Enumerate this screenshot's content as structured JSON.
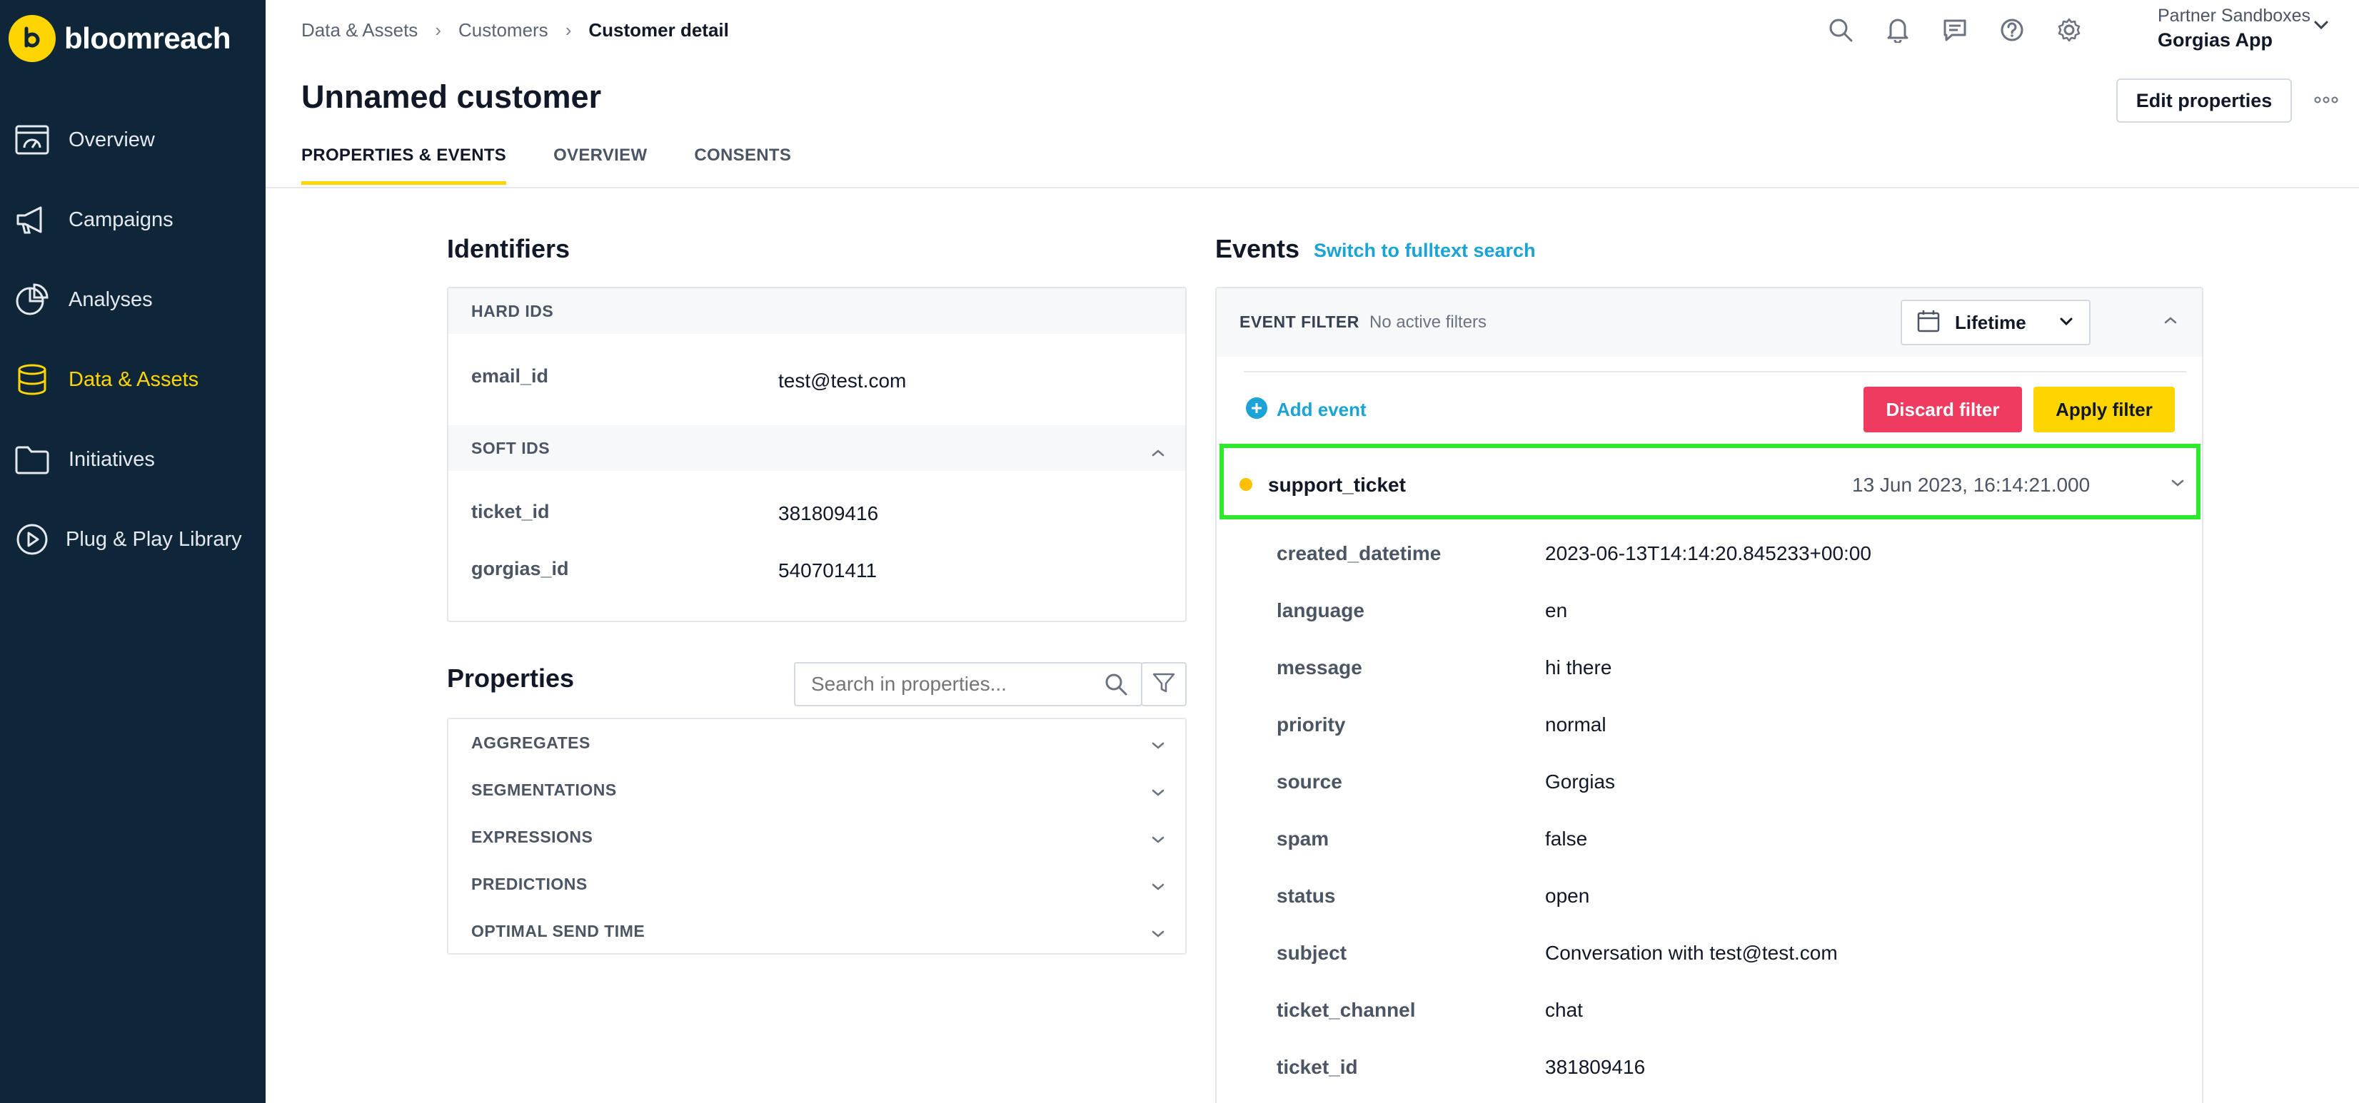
{
  "brand": {
    "name": "bloomreach",
    "accent": "#ffd500",
    "sidebar_bg": "#0f2639"
  },
  "sidebar": {
    "items": [
      {
        "label": "Overview",
        "icon": "dashboard-icon"
      },
      {
        "label": "Campaigns",
        "icon": "megaphone-icon"
      },
      {
        "label": "Analyses",
        "icon": "pie-chart-icon"
      },
      {
        "label": "Data & Assets",
        "icon": "database-icon",
        "active": true
      },
      {
        "label": "Initiatives",
        "icon": "folder-icon"
      },
      {
        "label": "Plug & Play Library",
        "icon": "play-circle-icon"
      }
    ]
  },
  "breadcrumb": {
    "items": [
      "Data & Assets",
      "Customers"
    ],
    "current": "Customer detail"
  },
  "topbar": {
    "icons": [
      "search-icon",
      "bell-icon",
      "chat-icon",
      "help-icon",
      "gear-icon"
    ],
    "account_sub": "Partner Sandboxes",
    "account_name": "Gorgias App"
  },
  "page": {
    "title": "Unnamed customer",
    "edit_label": "Edit properties",
    "tabs": [
      "PROPERTIES & EVENTS",
      "OVERVIEW",
      "CONSENTS"
    ],
    "active_tab": "PROPERTIES & EVENTS"
  },
  "identifiers": {
    "title": "Identifiers",
    "hard_ids_label": "HARD IDS",
    "hard_ids": [
      {
        "key": "email_id",
        "value": "test@test.com"
      }
    ],
    "soft_ids_label": "SOFT IDS",
    "soft_ids": [
      {
        "key": "ticket_id",
        "value": "381809416"
      },
      {
        "key": "gorgias_id",
        "value": "540701411"
      }
    ]
  },
  "properties": {
    "title": "Properties",
    "search_placeholder": "Search in properties...",
    "groups": [
      "AGGREGATES",
      "SEGMENTATIONS",
      "EXPRESSIONS",
      "PREDICTIONS",
      "OPTIMAL SEND TIME"
    ]
  },
  "events": {
    "title": "Events",
    "switch_link": "Switch to fulltext search",
    "filter_label": "EVENT FILTER",
    "filter_note": "No active filters",
    "range": "Lifetime",
    "add_event": "Add event",
    "discard": "Discard filter",
    "apply": "Apply filter",
    "event": {
      "name": "support_ticket",
      "time": "13 Jun 2023, 16:14:21.000",
      "highlight_color": "#2ee82e",
      "attributes": [
        {
          "key": "created_datetime",
          "value": "2023-06-13T14:14:20.845233+00:00"
        },
        {
          "key": "language",
          "value": "en"
        },
        {
          "key": "message",
          "value": "hi there"
        },
        {
          "key": "priority",
          "value": "normal"
        },
        {
          "key": "source",
          "value": "Gorgias"
        },
        {
          "key": "spam",
          "value": "false"
        },
        {
          "key": "status",
          "value": "open"
        },
        {
          "key": "subject",
          "value": "Conversation with test@test.com"
        },
        {
          "key": "ticket_channel",
          "value": "chat"
        },
        {
          "key": "ticket_id",
          "value": "381809416"
        }
      ]
    }
  }
}
